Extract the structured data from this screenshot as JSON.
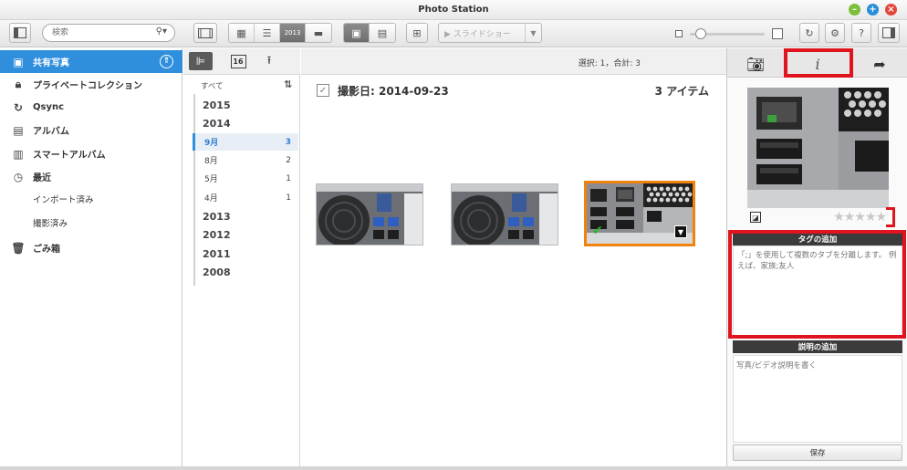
{
  "window": {
    "title": "Photo Station"
  },
  "toolbar": {
    "search_placeholder": "検索",
    "slideshow_label": "スライドショー",
    "timeline_view_label": "2013"
  },
  "sidebar": {
    "items": [
      {
        "label": "共有写真",
        "icon": "shared-photos-icon",
        "selected": true
      },
      {
        "label": "プライベートコレクション",
        "icon": "lock-icon"
      },
      {
        "label": "Qsync",
        "icon": "qsync-icon"
      },
      {
        "label": "アルバム",
        "icon": "album-icon"
      },
      {
        "label": "スマートアルバム",
        "icon": "smart-album-icon"
      },
      {
        "label": "最近",
        "icon": "clock-icon"
      },
      {
        "label": "インポート済み",
        "sub": true
      },
      {
        "label": "撮影済み",
        "sub": true
      },
      {
        "label": "ごみ箱",
        "icon": "trash-icon"
      }
    ]
  },
  "timeline": {
    "tab_calendar_day": "16",
    "all_label": "すべて",
    "rows": [
      {
        "type": "year",
        "label": "2015"
      },
      {
        "type": "year",
        "label": "2014"
      },
      {
        "type": "month",
        "label": "9月",
        "count": "3",
        "selected": true
      },
      {
        "type": "month",
        "label": "8月",
        "count": "2"
      },
      {
        "type": "month",
        "label": "5月",
        "count": "1"
      },
      {
        "type": "month",
        "label": "4月",
        "count": "1"
      },
      {
        "type": "year",
        "label": "2013"
      },
      {
        "type": "year",
        "label": "2012"
      },
      {
        "type": "year",
        "label": "2011"
      },
      {
        "type": "year",
        "label": "2008"
      }
    ]
  },
  "main": {
    "selection_status": "選択: 1，合計: 3",
    "group_date": "撮影日: 2014-09-23",
    "group_count": "3 アイテム"
  },
  "right_panel": {
    "tag_section_title": "タグの追加",
    "tag_placeholder": "「;」を使用して複数のタブを分離します。 例えば、家族;友人",
    "description_section_title": "説明の追加",
    "description_placeholder": "写真/ビデオ説明を書く",
    "save_label": "保存",
    "rating_stars": "★★★★★"
  },
  "colors": {
    "accent": "#2f8fdc",
    "selection_border": "#f0820e",
    "highlight_box": "#e0141e"
  }
}
